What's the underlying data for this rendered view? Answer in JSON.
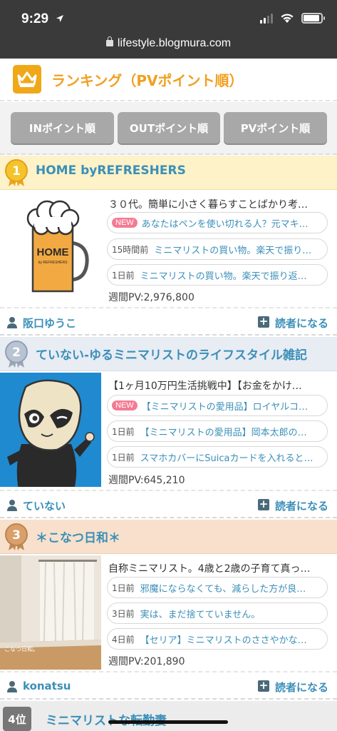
{
  "status": {
    "time": "9:29"
  },
  "browser": {
    "url": "lifestyle.blogmura.com"
  },
  "header": {
    "title": "ランキング（PVポイント順）"
  },
  "tabs": [
    {
      "label": "INポイント順"
    },
    {
      "label": "OUTポイント順"
    },
    {
      "label": "PVポイント順"
    }
  ],
  "entries": [
    {
      "rank": "1",
      "title": "HOME byREFRESHERS",
      "thumb_text": "HOME",
      "thumb_sub": "by REFRESHERS",
      "description": "３０代。簡単に小さく暮らすことばかり考…",
      "posts": [
        {
          "badge": "NEW",
          "text": "あなたはペンを使い切れる人？元マキ…"
        },
        {
          "time": "15時間前",
          "text": "ミニマリストの買い物。楽天で振り…"
        },
        {
          "time": "1日前",
          "text": "ミニマリストの買い物。楽天で振り返…"
        }
      ],
      "pv": "週間PV:2,976,800",
      "author": "阪口ゆうこ",
      "reader_label": "読者になる"
    },
    {
      "rank": "2",
      "title": "ていない-ゆるミニマリストのライフスタイル雑記",
      "description": "【1ヶ月10万円生活挑戦中】【お金をかけ…",
      "posts": [
        {
          "badge": "NEW",
          "text": "【ミニマリストの愛用品】ロイヤルコ…"
        },
        {
          "time": "1日前",
          "text": "【ミニマリストの愛用品】岡本太郎の…"
        },
        {
          "time": "1日前",
          "text": "スマホカバーにSuicaカードを入れると…"
        }
      ],
      "pv": "週間PV:645,210",
      "author": "ていない",
      "reader_label": "読者になる"
    },
    {
      "rank": "3",
      "title": "＊こなつ日和＊",
      "thumb_text": "こなつ日和。",
      "description": "自称ミニマリスト。4歳と2歳の子育て真っ…",
      "posts": [
        {
          "time": "1日前",
          "text": "邪魔にならなくても、減らした方が良…"
        },
        {
          "time": "3日前",
          "text": "実は、まだ捨てていません。"
        },
        {
          "time": "4日前",
          "text": "【セリア】ミニマリストのささやかな…"
        }
      ],
      "pv": "週間PV:201,890",
      "author": "konatsu",
      "reader_label": "読者になる"
    }
  ],
  "next_entry": {
    "rank_label": "4位",
    "title": "ミニマリストな転勤妻"
  }
}
